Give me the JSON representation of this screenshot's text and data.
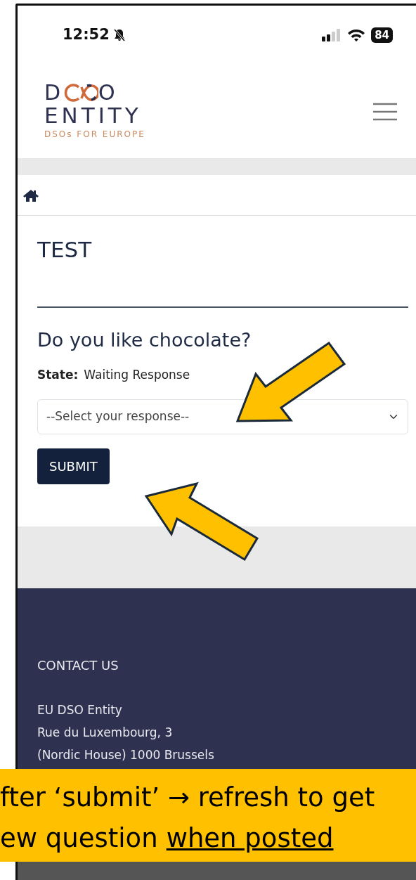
{
  "status_bar": {
    "time": "12:52",
    "battery": "84"
  },
  "logo": {
    "letter_left": "D",
    "letter_right": "O",
    "word": "ENTITY",
    "tagline": "DSOs FOR EUROPE"
  },
  "page": {
    "title": "TEST",
    "question": "Do you like chocolate?",
    "state_label": "State:",
    "state_value": "Waiting Response",
    "select": {
      "placeholder": "--Select your response--"
    },
    "submit": "SUBMIT"
  },
  "footer": {
    "heading": "CONTACT US",
    "lines": [
      "EU DSO Entity",
      "Rue du Luxembourg, 3",
      "(Nordic House) 1000 Brussels"
    ]
  },
  "callout": {
    "line_1": "fter ‘submit’ → refresh to get",
    "line_2": "ew question",
    "line_2_underlined": "when posted"
  }
}
